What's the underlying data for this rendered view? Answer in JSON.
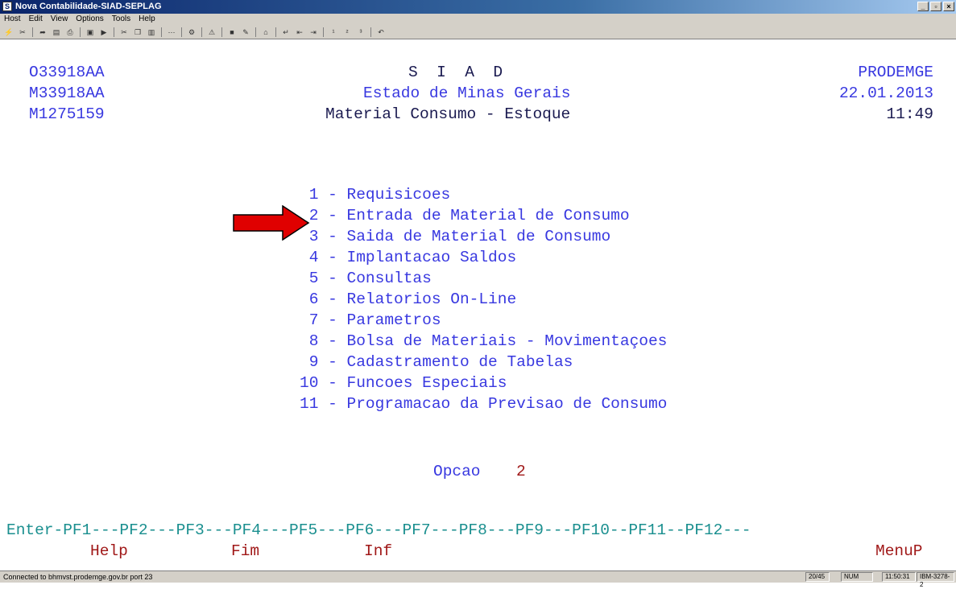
{
  "window": {
    "title": "Nova Contabilidade-SIAD-SEPLAG",
    "minimize": "_",
    "maximize": "▫",
    "close": "×"
  },
  "menu": [
    "Host",
    "Edit",
    "View",
    "Options",
    "Tools",
    "Help"
  ],
  "header": {
    "left": [
      "O33918AA",
      "M33918AA",
      "M1275159"
    ],
    "center": [
      "S  I  A  D",
      "Estado de Minas Gerais",
      "Material Consumo - Estoque"
    ],
    "right": [
      "PRODEMGE",
      "22.01.2013",
      "11:49"
    ]
  },
  "menu_options": [
    {
      "num": " 1",
      "label": "Requisicoes"
    },
    {
      "num": " 2",
      "label": "Entrada de Material de Consumo"
    },
    {
      "num": " 3",
      "label": "Saida de Material de Consumo"
    },
    {
      "num": " 4",
      "label": "Implantacao Saldos"
    },
    {
      "num": " 5",
      "label": "Consultas"
    },
    {
      "num": " 6",
      "label": "Relatorios On-Line"
    },
    {
      "num": " 7",
      "label": "Parametros"
    },
    {
      "num": " 8",
      "label": "Bolsa de Materiais - Movimentaçoes"
    },
    {
      "num": " 9",
      "label": "Cadastramento de Tabelas"
    },
    {
      "num": "10",
      "label": "Funcoes Especiais"
    },
    {
      "num": "11",
      "label": "Programacao da Previsao de Consumo"
    }
  ],
  "option_prompt": {
    "label": "Opcao",
    "value": "2"
  },
  "pf_keys_line": "Enter-PF1---PF2---PF3---PF4---PF5---PF6---PF7---PF8---PF9---PF10--PF11--PF12---",
  "pf_labels": {
    "pf1": "Help",
    "pf3": "Fim",
    "pf5": "Inf",
    "pf12": "MenuP"
  },
  "status": {
    "connection": "Connected to bhmvst.prodemge.gov.br port 23",
    "cursor": "20/45",
    "num": "NUM",
    "clock": "11:50:31",
    "terminal": "IBM-3278-2"
  },
  "colors": {
    "field_blue": "#3838e0",
    "arrow_red": "#e00000",
    "pf_teal": "#1a8f8f",
    "pf_label_red": "#a01818"
  }
}
